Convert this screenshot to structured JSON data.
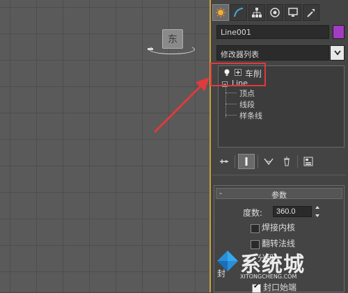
{
  "viewport": {
    "viewcube_label": "东"
  },
  "command_panel": {
    "tabs": [
      {
        "icon": "create-icon",
        "active": true
      },
      {
        "icon": "modify-icon",
        "active": false
      },
      {
        "icon": "hierarchy-icon",
        "active": false
      },
      {
        "icon": "motion-icon",
        "active": false
      },
      {
        "icon": "display-icon",
        "active": false
      },
      {
        "icon": "utilities-icon",
        "active": false
      }
    ],
    "object_name": "Line001",
    "object_color": "#a33cc4",
    "modifier_list_label": "修改器列表",
    "stack": {
      "lathe_label": "车削",
      "line_label": "Line",
      "sub_items": [
        "顶点",
        "线段",
        "样条线"
      ]
    },
    "params": {
      "rollout_minus": "-",
      "rollout_title": "参数",
      "degrees_label": "度数:",
      "degrees_value": "360.0",
      "weld_core_label": "焊接内核",
      "flip_normals_label": "翻转法线",
      "segments_label": "分段",
      "capping_label": "封",
      "cap_start_label": "封口始端"
    }
  },
  "watermark": {
    "text": "系统城",
    "url": "XITONGCHENG.COM"
  },
  "colors": {
    "highlight": "#e03a3a",
    "accent_border": "#c9a23a"
  }
}
